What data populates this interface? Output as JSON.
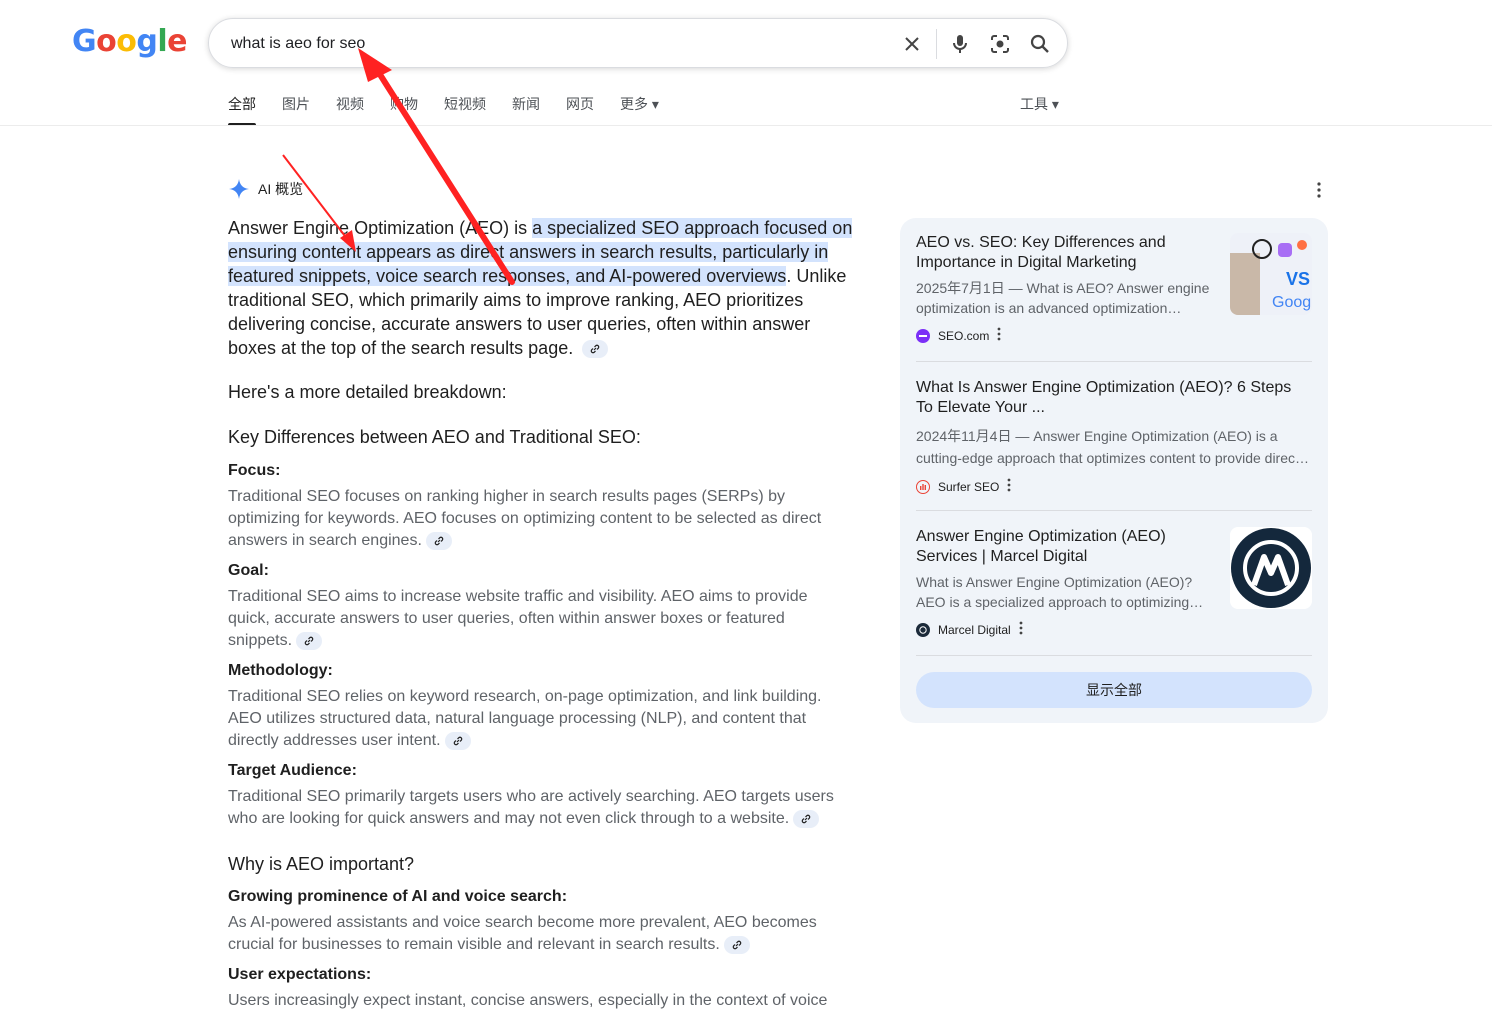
{
  "logo": {
    "letters": [
      "G",
      "o",
      "o",
      "g",
      "l",
      "e"
    ]
  },
  "search": {
    "value": "what is aeo for seo"
  },
  "tabs": [
    {
      "label": "全部"
    },
    {
      "label": "图片"
    },
    {
      "label": "视频"
    },
    {
      "label": "购物"
    },
    {
      "label": "短视频"
    },
    {
      "label": "新闻"
    },
    {
      "label": "网页"
    },
    {
      "label": "更多 ▾"
    }
  ],
  "tools_label": "工具 ▾",
  "ai_overview": {
    "title": "AI 概览",
    "lead_before": "Answer Engine Optimization (AEO) is ",
    "lead_highlight": "a specialized SEO approach focused on ensuring content appears as direct answers in search results, particularly in featured snippets, voice search responses, and AI-powered overviews",
    "lead_after": ". Unlike traditional SEO, which primarily aims to improve ranking, AEO prioritizes delivering concise, accurate answers to user queries, often within answer boxes at the top of the search results page.",
    "breakdown": "Here's a more detailed breakdown:",
    "diff_heading": "Key Differences between AEO and Traditional SEO:",
    "items": [
      {
        "label": "Focus:",
        "text": "Traditional SEO focuses on ranking higher in search results pages (SERPs) by optimizing for keywords. AEO focuses on optimizing content to be selected as direct answers in search engines."
      },
      {
        "label": "Goal:",
        "text": "Traditional SEO aims to increase website traffic and visibility. AEO aims to provide quick, accurate answers to user queries, often within answer boxes or featured snippets."
      },
      {
        "label": "Methodology:",
        "text": "Traditional SEO relies on keyword research, on-page optimization, and link building. AEO utilizes structured data, natural language processing (NLP), and content that directly addresses user intent."
      },
      {
        "label": "Target Audience:",
        "text": "Traditional SEO primarily targets users who are actively searching. AEO targets users who are looking for quick answers and may not even click through to a website."
      }
    ],
    "why_heading": "Why is AEO important?",
    "why_items": [
      {
        "label": "Growing prominence of AI and voice search:",
        "text": "As AI-powered assistants and voice search become more prevalent, AEO becomes crucial for businesses to remain visible and relevant in search results."
      },
      {
        "label": "User expectations:",
        "text": "Users increasingly expect instant, concise answers, especially in the context of voice"
      }
    ]
  },
  "sources": [
    {
      "title": "AEO vs. SEO: Key Differences and Importance in Digital Marketing",
      "snippet": "2025年7月1日 — What is AEO? Answer engine optimization is an advanced optimization…",
      "site": "SEO.com",
      "color": "#7b2ff7"
    },
    {
      "title": "What Is Answer Engine Optimization (AEO)? 6 Steps To Elevate Your ...",
      "snippet": "2024年11月4日 — Answer Engine Optimization (AEO) is a cutting-edge approach that optimizes content to provide direc…",
      "site": "Surfer SEO",
      "color": "#ea4335"
    },
    {
      "title": "Answer Engine Optimization (AEO) Services | Marcel Digital",
      "snippet": "What is Answer Engine Optimization (AEO)? AEO is a specialized approach to optimizing…",
      "site": "Marcel Digital",
      "color": "#1b2a3a"
    }
  ],
  "show_all_label": "显示全部",
  "thumb1_text": "VS Goog"
}
